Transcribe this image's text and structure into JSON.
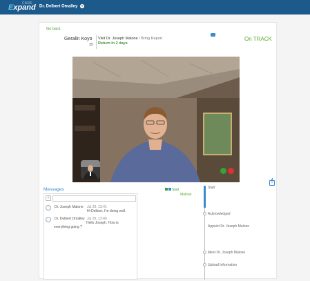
{
  "app": {
    "logo_top": "CARE",
    "logo_main_a": "E",
    "logo_main_b": "xpand",
    "user_name": "Dr. Delbert Omalley",
    "user_caret": "▾"
  },
  "visit": {
    "back_label": "Go back",
    "patient_name": "Geralin Koyo",
    "patient_age": "35",
    "title_main": "Visit Dr. Joseph Malone",
    "title_sub": "/ Bring Report",
    "return_label": "Return in 2 days",
    "status": "On TRACK"
  },
  "messages": {
    "title": "Messages",
    "plus_label": "+",
    "input_placeholder": "",
    "items": [
      {
        "sender": "Dr. Joseph Malone",
        "time": "Jul 20, 13:41",
        "text": "Hi Delbert, I'm doing well."
      },
      {
        "sender": "Dr. Delbert Omalley",
        "time": "Jul 20, 13:40",
        "text": "Hello Joseph. How is everything going ?"
      }
    ]
  },
  "flags": {
    "label": "Start",
    "name": "Malone"
  },
  "timeline": {
    "items": [
      {
        "label": "Start"
      },
      {
        "label": "Acknowledged"
      },
      {
        "label": "Appoint Dr. Joseph Malone"
      },
      {
        "label": "Meet Dr. Joseph Malone"
      },
      {
        "label": "Upload Information"
      }
    ]
  },
  "colors": {
    "header": "#1d5a8c",
    "accent": "#3a8ad0",
    "success": "#5aac2a"
  },
  "icons": {
    "chat": "chat-icon",
    "microphone": "microphone-icon",
    "end_call": "end-call-icon",
    "add": "plus-icon"
  }
}
